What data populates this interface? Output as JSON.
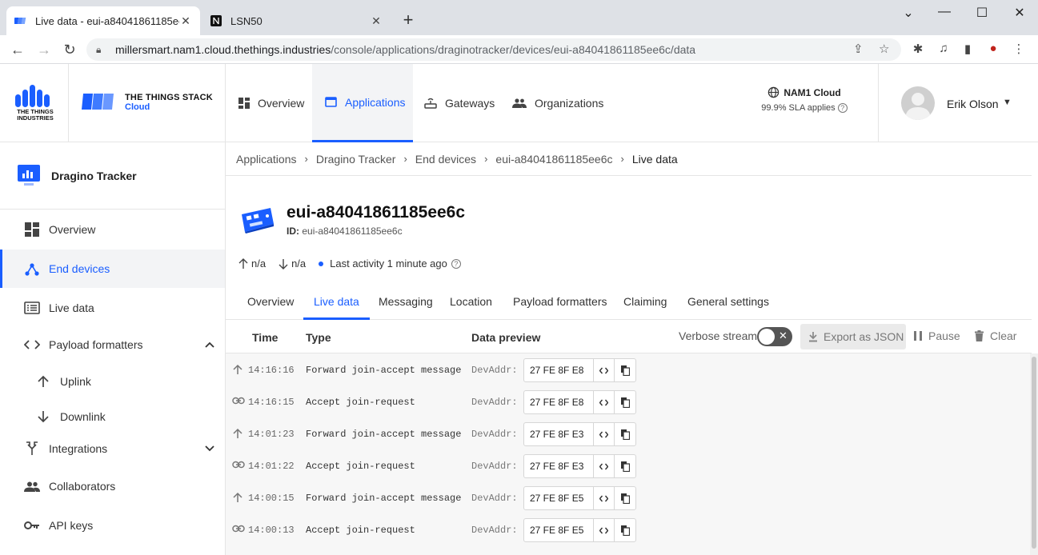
{
  "browser": {
    "tabs": [
      {
        "title": "Live data - eui-a84041861185ee6c",
        "active": true
      },
      {
        "title": "LSN50",
        "active": false
      }
    ],
    "url_host": "millersmart.nam1.cloud.thethings.industries",
    "url_path": "/console/applications/draginotracker/devices/eui-a84041861185ee6c/data"
  },
  "header": {
    "tti_logo_text": "THE THINGS INDUSTRIES",
    "tts_line1": "THE THINGS STACK",
    "tts_line2": "Cloud",
    "nav": [
      {
        "label": "Overview",
        "icon": "dashboard-icon"
      },
      {
        "label": "Applications",
        "icon": "application-icon"
      },
      {
        "label": "Gateways",
        "icon": "gateway-icon"
      },
      {
        "label": "Organizations",
        "icon": "organization-icon"
      }
    ],
    "cluster_name": "NAM1 Cloud",
    "sla_text": "99.9% SLA applies",
    "user_name": "Erik Olson"
  },
  "sidebar": {
    "app_name": "Dragino Tracker",
    "items": [
      {
        "label": "Overview",
        "icon": "dashboard-icon"
      },
      {
        "label": "End devices",
        "icon": "devices-icon"
      },
      {
        "label": "Live data",
        "icon": "list-icon"
      },
      {
        "label": "Payload formatters",
        "icon": "code-icon"
      },
      {
        "label": "Uplink",
        "icon": "arrow-up-icon"
      },
      {
        "label": "Downlink",
        "icon": "arrow-down-icon"
      },
      {
        "label": "Integrations",
        "icon": "merge-icon"
      },
      {
        "label": "Collaborators",
        "icon": "people-icon"
      },
      {
        "label": "API keys",
        "icon": "key-icon"
      }
    ]
  },
  "breadcrumb": [
    "Applications",
    "Dragino Tracker",
    "End devices",
    "eui-a84041861185ee6c",
    "Live data"
  ],
  "device": {
    "title": "eui-a84041861185ee6c",
    "id_label": "ID:",
    "id_value": "eui-a84041861185ee6c",
    "uplink_count": "n/a",
    "downlink_count": "n/a",
    "last_activity": "Last activity 1 minute ago"
  },
  "device_tabs": [
    "Overview",
    "Live data",
    "Messaging",
    "Location",
    "Payload formatters",
    "Claiming",
    "General settings"
  ],
  "live": {
    "col_time": "Time",
    "col_type": "Type",
    "col_preview": "Data preview",
    "verbose_label": "Verbose stream",
    "export_label": "Export as JSON",
    "pause_label": "Pause",
    "clear_label": "Clear",
    "events": [
      {
        "icon": "arrow-up-icon",
        "time": "14:16:16",
        "type": "Forward join-accept message",
        "label": "DevAddr:",
        "value": "27 FE 8F E8"
      },
      {
        "icon": "link-icon",
        "time": "14:16:15",
        "type": "Accept join-request",
        "label": "DevAddr:",
        "value": "27 FE 8F E8"
      },
      {
        "icon": "arrow-up-icon",
        "time": "14:01:23",
        "type": "Forward join-accept message",
        "label": "DevAddr:",
        "value": "27 FE 8F E3"
      },
      {
        "icon": "link-icon",
        "time": "14:01:22",
        "type": "Accept join-request",
        "label": "DevAddr:",
        "value": "27 FE 8F E3"
      },
      {
        "icon": "arrow-up-icon",
        "time": "14:00:15",
        "type": "Forward join-accept message",
        "label": "DevAddr:",
        "value": "27 FE 8F E5"
      },
      {
        "icon": "link-icon",
        "time": "14:00:13",
        "type": "Accept join-request",
        "label": "DevAddr:",
        "value": "27 FE 8F E5"
      }
    ]
  },
  "colors": {
    "accent": "#1a5eff"
  }
}
